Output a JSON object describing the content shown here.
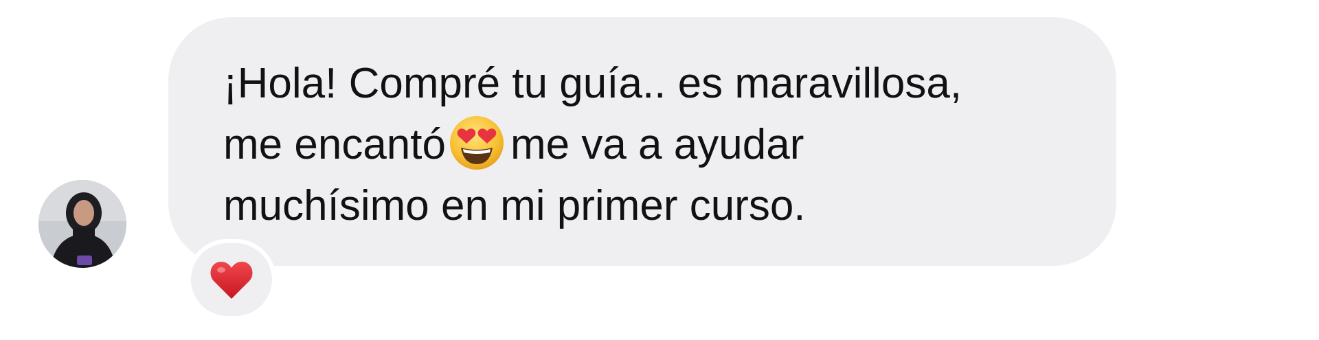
{
  "message": {
    "lines": [
      "¡Hola! Compré tu guía.. es maravillosa,",
      "me encantó",
      "me va a ayudar",
      "muchísimo en mi primer curso."
    ],
    "inline_emoji": "heart-eyes-emoji"
  },
  "reaction": {
    "emoji": "red-heart-icon"
  },
  "sender": {
    "avatar": "profile-photo"
  },
  "colors": {
    "bubble": "#efeff2",
    "text": "#111111",
    "heart": "#e0242e"
  }
}
